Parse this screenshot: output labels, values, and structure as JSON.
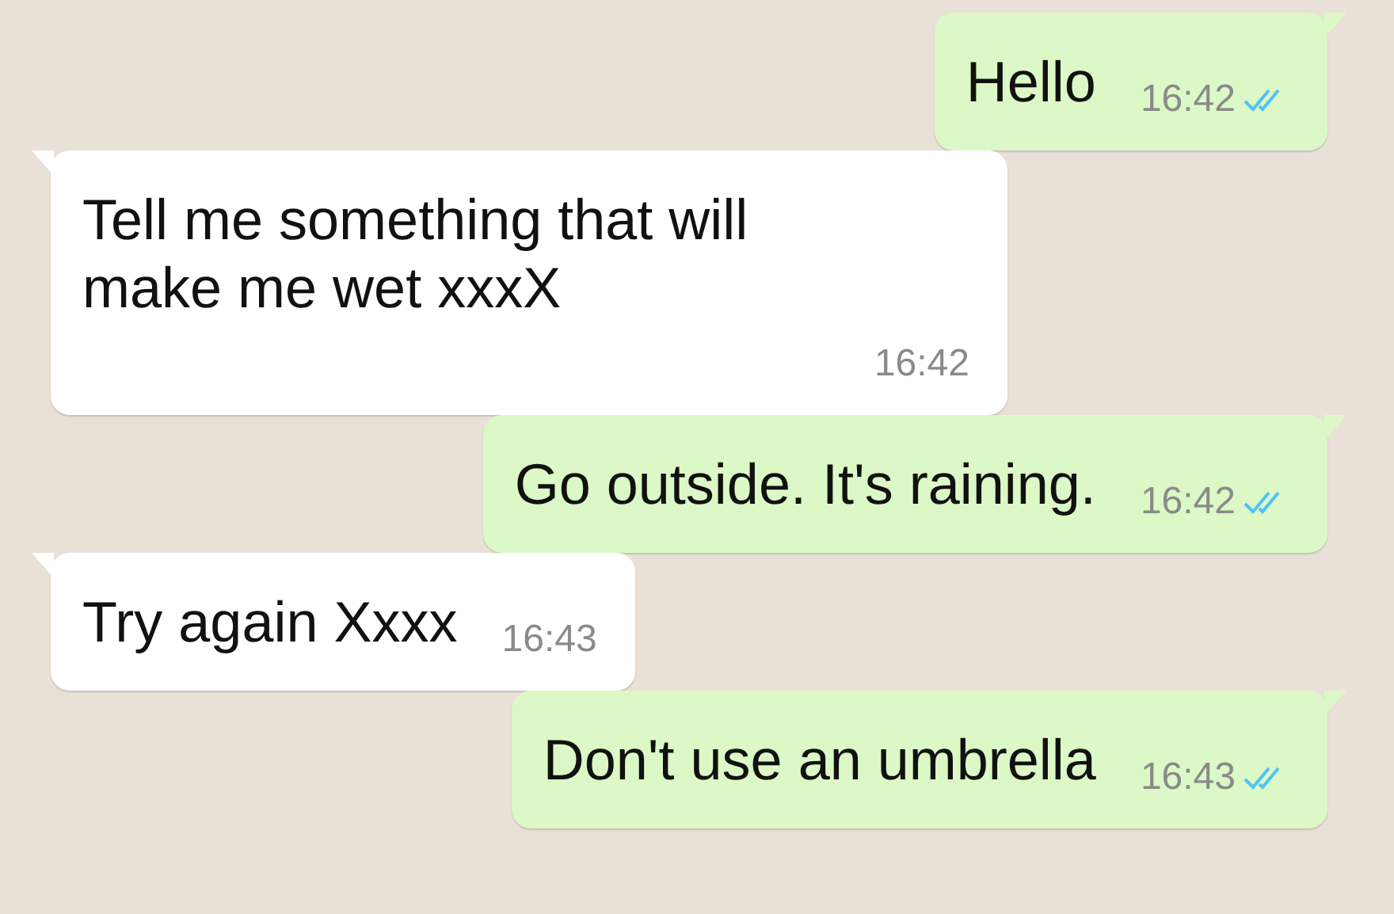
{
  "messages": [
    {
      "kind": "outgoing",
      "text": "Hello",
      "time": "16:42",
      "read": true
    },
    {
      "kind": "incoming",
      "text": "Tell me something that will make me wet xxxX",
      "time": "16:42"
    },
    {
      "kind": "outgoing",
      "text": "Go outside. It's raining.",
      "time": "16:42",
      "read": true
    },
    {
      "kind": "incoming",
      "text": "Try again Xxxx",
      "time": "16:43"
    },
    {
      "kind": "outgoing",
      "text": "Don't use an umbrella",
      "time": "16:43",
      "read": true
    }
  ]
}
